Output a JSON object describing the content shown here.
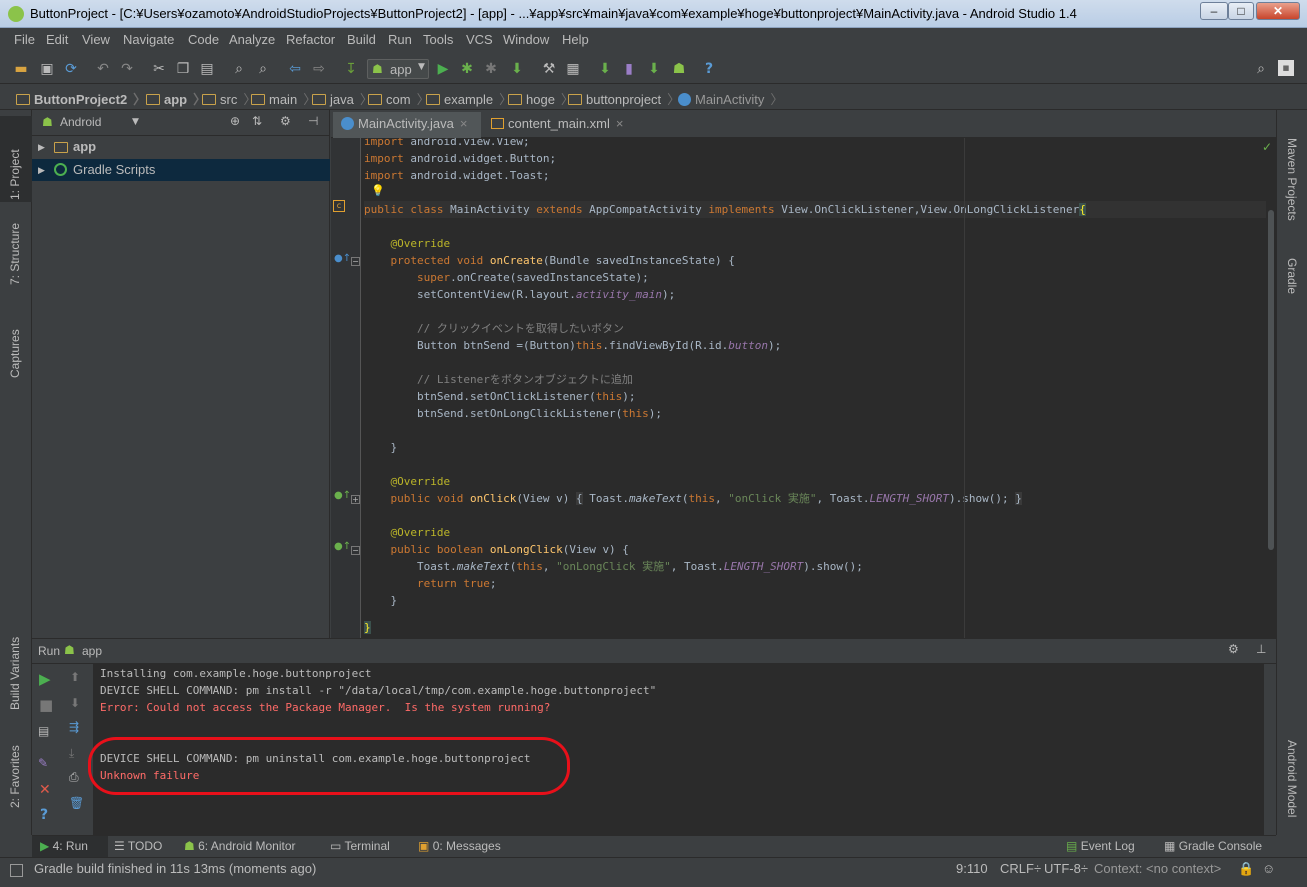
{
  "window": {
    "title": "ButtonProject - [C:¥Users¥ozamoto¥AndroidStudioProjects¥ButtonProject2] - [app] - ...¥app¥src¥main¥java¥com¥example¥hoge¥buttonproject¥MainActivity.java - Android Studio 1.4"
  },
  "menu": [
    "File",
    "Edit",
    "View",
    "Navigate",
    "Code",
    "Analyze",
    "Refactor",
    "Build",
    "Run",
    "Tools",
    "VCS",
    "Window",
    "Help"
  ],
  "toolbar": {
    "run_config": "app"
  },
  "breadcrumb": [
    "ButtonProject2",
    "app",
    "src",
    "main",
    "java",
    "com",
    "example",
    "hoge",
    "buttonproject",
    "MainActivity"
  ],
  "left_tabs": {
    "project": "1: Project",
    "structure": "7: Structure",
    "captures": "Captures",
    "build_variants": "Build Variants",
    "favorites": "2: Favorites"
  },
  "right_tabs": {
    "maven": "Maven Projects",
    "gradle": "Gradle",
    "android_model": "Android Model"
  },
  "project_panel": {
    "view_mode": "Android",
    "tree": [
      "app",
      "Gradle Scripts"
    ]
  },
  "editor_tabs": [
    "MainActivity.java",
    "content_main.xml"
  ],
  "code_lines": [
    "import android.view.View;",
    "import android.widget.Button;",
    "import android.widget.Toast;",
    "",
    "public class MainActivity extends AppCompatActivity implements View.OnClickListener,View.OnLongClickListener{",
    "",
    "    @Override",
    "    protected void onCreate(Bundle savedInstanceState) {",
    "        super.onCreate(savedInstanceState);",
    "        setContentView(R.layout.activity_main);",
    "",
    "        // クリックイベントを取得したいボタン",
    "        Button btnSend =(Button)this.findViewById(R.id.button);",
    "",
    "        // Listenerをボタンオブジェクトに追加",
    "        btnSend.setOnClickListener(this);",
    "        btnSend.setOnLongClickListener(this);",
    "",
    "    }",
    "",
    "    @Override",
    "    public void onClick(View v) { Toast.makeText(this, \"onClick 実施\", Toast.LENGTH_SHORT).show(); }",
    "",
    "    @Override",
    "    public boolean onLongClick(View v) {",
    "        Toast.makeText(this, \"onLongClick 実施\", Toast.LENGTH_SHORT).show();",
    "        return true;",
    "    }",
    "",
    "}"
  ],
  "run_panel": {
    "label": "Run",
    "config": "app"
  },
  "console_lines": [
    {
      "text": "Installing com.example.hoge.buttonproject",
      "error": false
    },
    {
      "text": "DEVICE SHELL COMMAND: pm install -r \"/data/local/tmp/com.example.hoge.buttonproject\"",
      "error": false
    },
    {
      "text": "Error: Could not access the Package Manager.  Is the system running?",
      "error": true
    },
    {
      "text": "",
      "error": false
    },
    {
      "text": "DEVICE SHELL COMMAND: pm uninstall com.example.hoge.buttonproject",
      "error": false
    },
    {
      "text": "Unknown failure",
      "error": true
    }
  ],
  "tool_windows": {
    "run": "4: Run",
    "todo": "TODO",
    "android_monitor": "6: Android Monitor",
    "terminal": "Terminal",
    "messages": "0: Messages",
    "event_log": "Event Log",
    "gradle_console": "Gradle Console"
  },
  "status": {
    "message": "Gradle build finished in 11s 13ms (moments ago)",
    "position": "9:110",
    "line_sep": "CRLF÷",
    "encoding": "UTF-8÷",
    "context": "Context: <no context>"
  },
  "colors": {
    "accent_error": "#ff6b68",
    "annotation_circle": "#e8101a"
  }
}
